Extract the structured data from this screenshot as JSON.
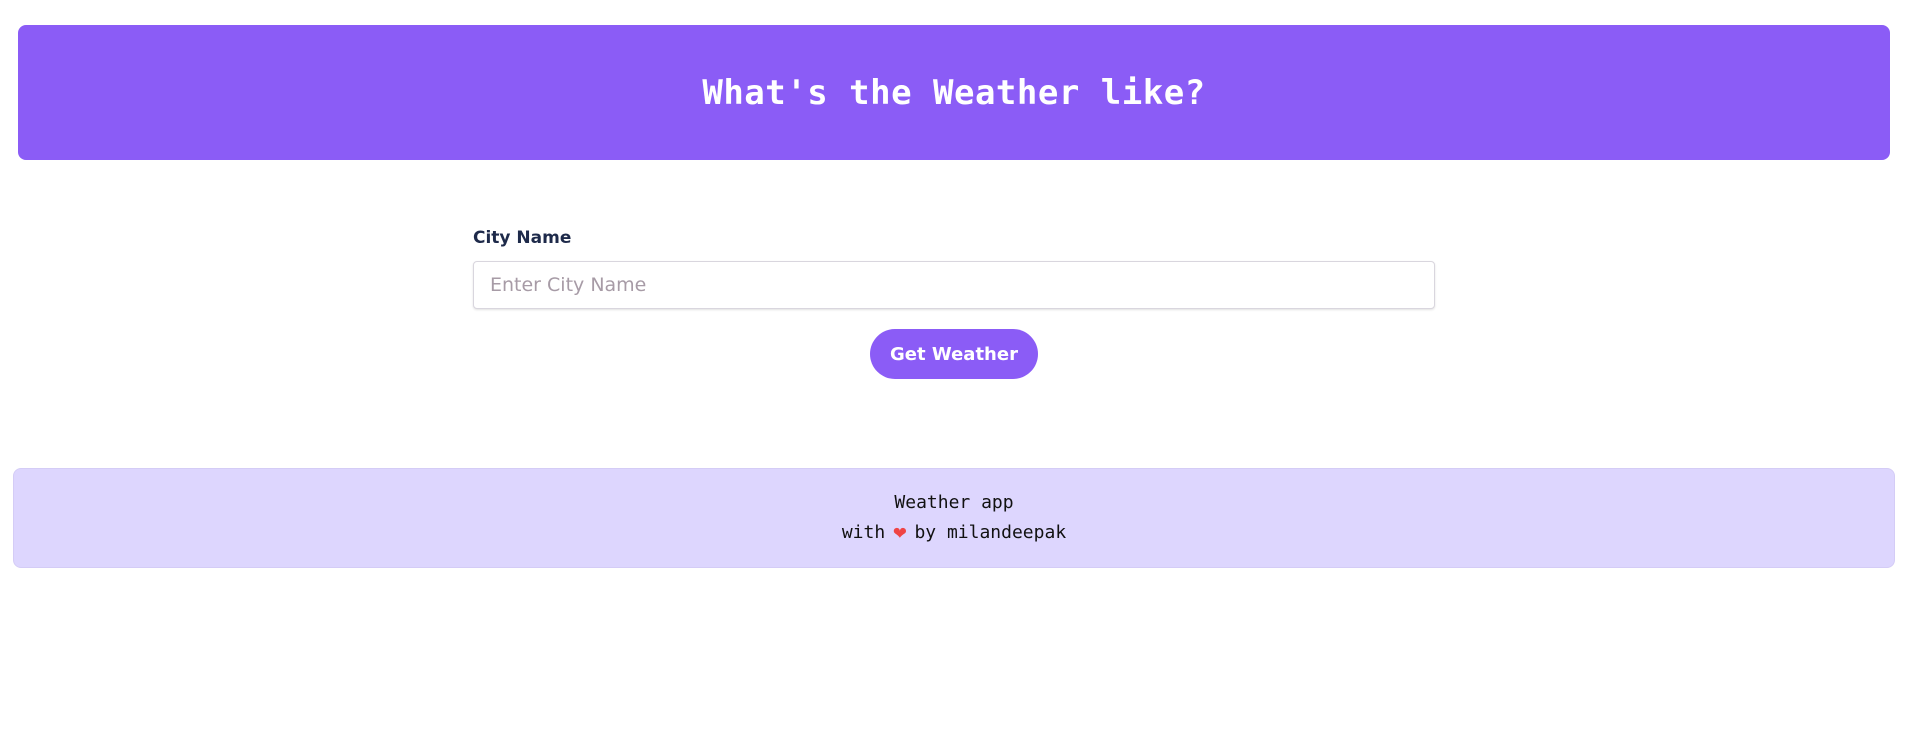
{
  "header": {
    "title": "What's the Weather like?"
  },
  "form": {
    "label": "City Name",
    "input_value": "",
    "input_placeholder": "Enter City Name",
    "button_label": "Get Weather"
  },
  "footer": {
    "line1": "Weather app",
    "line2_prefix": "with",
    "line2_suffix": "by milandeepak",
    "icon": "heart-icon"
  },
  "colors": {
    "accent": "#8b5cf6",
    "footer_bg": "#ddd6fe",
    "heart": "#ef4444"
  }
}
